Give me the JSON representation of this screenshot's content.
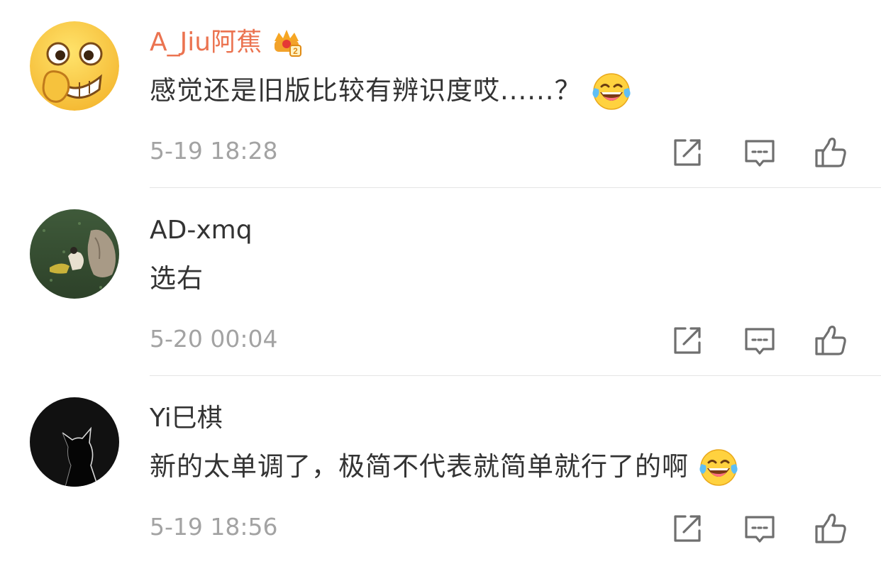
{
  "comments": [
    {
      "username": "A_Jiu阿蕉",
      "username_color": "#eb7350",
      "badge": "vip-crown-icon",
      "text": "感觉还是旧版比较有辨识度哎......？",
      "emoji": "laugh-cry-emoji",
      "time": "5-19 18:28",
      "avatar": "grin-face-emoji-avatar"
    },
    {
      "username": "AD-xmq",
      "username_color": "#333333",
      "text": "选右",
      "time": "5-20 00:04",
      "avatar": "grass-field-photo-avatar"
    },
    {
      "username": "Yi巳棋",
      "username_color": "#333333",
      "text": "新的太单调了，极简不代表就简单就行了的啊",
      "emoji": "laugh-cry-emoji",
      "time": "5-19 18:56",
      "avatar": "cat-silhouette-avatar"
    }
  ],
  "icons": {
    "share": "share-icon",
    "reply": "comment-icon",
    "like": "thumbs-up-icon"
  },
  "colors": {
    "vip_name": "#eb7350",
    "text": "#333333",
    "meta": "#a3a3a3",
    "icon": "#6f6f6f",
    "divider": "#e4e4e4"
  }
}
